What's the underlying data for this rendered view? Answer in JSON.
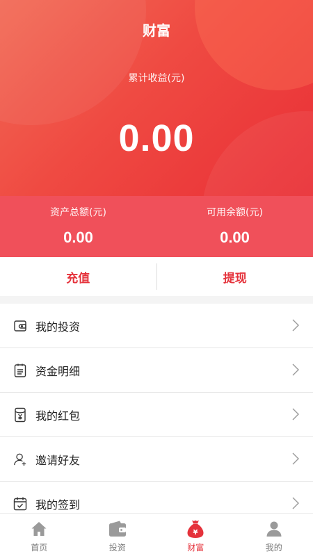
{
  "header": {
    "title": "财富"
  },
  "earnings": {
    "label": "累计收益(元)",
    "value": "0.00"
  },
  "assets": {
    "total_label": "资产总额(元)",
    "total_value": "0.00",
    "available_label": "可用余额(元)",
    "available_value": "0.00"
  },
  "actions": {
    "recharge": "充值",
    "withdraw": "提现"
  },
  "menu": {
    "items": [
      {
        "label": "我的投资",
        "icon": "wallet-icon"
      },
      {
        "label": "资金明细",
        "icon": "list-detail-icon"
      },
      {
        "label": "我的红包",
        "icon": "red-packet-icon"
      },
      {
        "label": "邀请好友",
        "icon": "invite-user-icon"
      },
      {
        "label": "我的签到",
        "icon": "calendar-check-icon"
      }
    ]
  },
  "tabbar": {
    "items": [
      {
        "label": "首页",
        "icon": "home-icon",
        "active": false
      },
      {
        "label": "投资",
        "icon": "wallet-icon",
        "active": false
      },
      {
        "label": "财富",
        "icon": "money-bag-icon",
        "active": true
      },
      {
        "label": "我的",
        "icon": "user-icon",
        "active": false
      }
    ]
  },
  "colors": {
    "accent": "#e5323b",
    "hero_start": "#f26a55",
    "hero_end": "#e92f36",
    "strip": "#f0505a",
    "inactive_icon": "#999999"
  }
}
